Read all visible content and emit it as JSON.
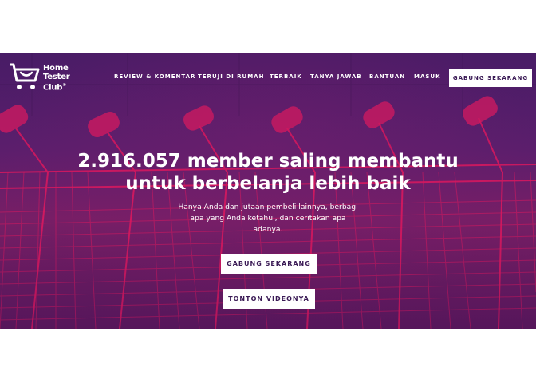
{
  "brand": {
    "line1": "Home",
    "line2": "Tester",
    "line3": "Club",
    "mark": "®"
  },
  "nav": {
    "items": [
      {
        "label": "REVIEW & KOMENTAR"
      },
      {
        "label": "TERUJI DI RUMAH"
      },
      {
        "label": "TERBAIK"
      },
      {
        "label": "TANYA JAWAB"
      },
      {
        "label": "BANTUAN"
      },
      {
        "label": "MASUK"
      }
    ],
    "cta": "GABUNG SEKARANG"
  },
  "hero": {
    "headline_line1": "2.916.057 member saling membantu",
    "headline_line2": "untuk berbelanja lebih baik",
    "sub_line1": "Hanya Anda dan jutaan pembeli lainnya, berbagi",
    "sub_line2": "apa yang Anda ketahui, dan ceritakan apa",
    "sub_line3": "adanya.",
    "join_button": "GABUNG SEKARANG",
    "video_button": "TONTON VIDEONYA"
  },
  "colors": {
    "accent": "#e0195f",
    "overlay": "#5a1f6e",
    "text": "#ffffff"
  },
  "icons": {
    "logo": "shopping-cart-smile-icon"
  }
}
